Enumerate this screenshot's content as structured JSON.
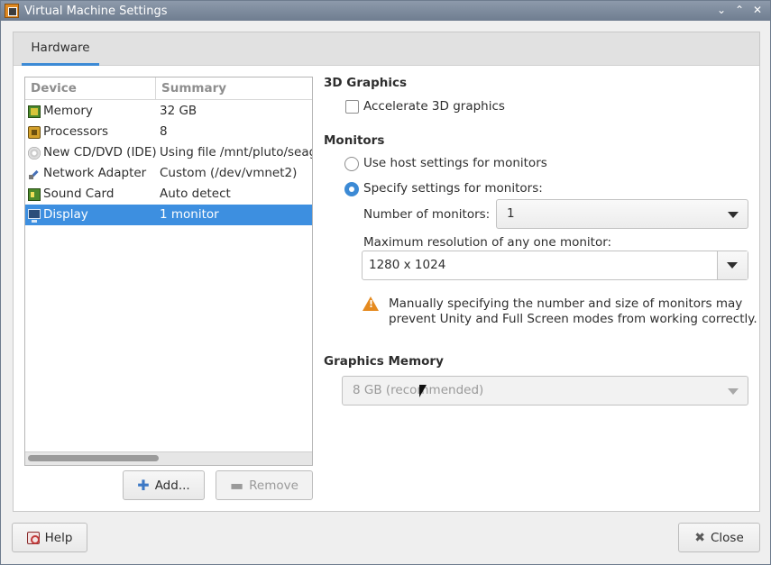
{
  "window": {
    "title": "Virtual Machine Settings",
    "controls": {
      "minimize": "⌄",
      "maximize": "⌃",
      "close": "✕"
    }
  },
  "tabs": [
    {
      "label": "Hardware",
      "active": true
    }
  ],
  "device_list": {
    "columns": {
      "device": "Device",
      "summary": "Summary"
    },
    "rows": [
      {
        "device": "Memory",
        "summary": "32 GB",
        "icon": "memory-icon"
      },
      {
        "device": "Processors",
        "summary": "8",
        "icon": "cpu-icon"
      },
      {
        "device": "New CD/DVD (IDE)",
        "summary": "Using file /mnt/pluto/seaga",
        "icon": "cd-icon"
      },
      {
        "device": "Network Adapter",
        "summary": "Custom (/dev/vmnet2)",
        "icon": "network-icon"
      },
      {
        "device": "Sound Card",
        "summary": "Auto detect",
        "icon": "sound-card-icon"
      },
      {
        "device": "Display",
        "summary": "1 monitor",
        "icon": "display-icon",
        "selected": true
      }
    ],
    "add_label": "Add...",
    "remove_label": "Remove"
  },
  "display_settings": {
    "graphics_3d": {
      "title": "3D Graphics",
      "accelerate_label": "Accelerate 3D graphics",
      "accelerate_checked": false
    },
    "monitors": {
      "title": "Monitors",
      "use_host_label": "Use host settings for monitors",
      "specify_label": "Specify settings for monitors:",
      "selected": "specify",
      "number_label": "Number of monitors:",
      "number_value": "1",
      "max_res_label": "Maximum resolution of any one monitor:",
      "max_res_value": "1280 x 1024",
      "warning_line1": "Manually specifying the number and size of monitors may",
      "warning_line2": "prevent Unity and Full Screen modes from working correctly."
    },
    "graphics_memory": {
      "title": "Graphics Memory",
      "value": "8 GB (recommended)",
      "disabled": true
    }
  },
  "footer": {
    "help_label": "Help",
    "close_label": "Close"
  },
  "colors": {
    "accent": "#3c8ad5",
    "selection": "#3d8fe0",
    "warning": "#e58a1f"
  }
}
